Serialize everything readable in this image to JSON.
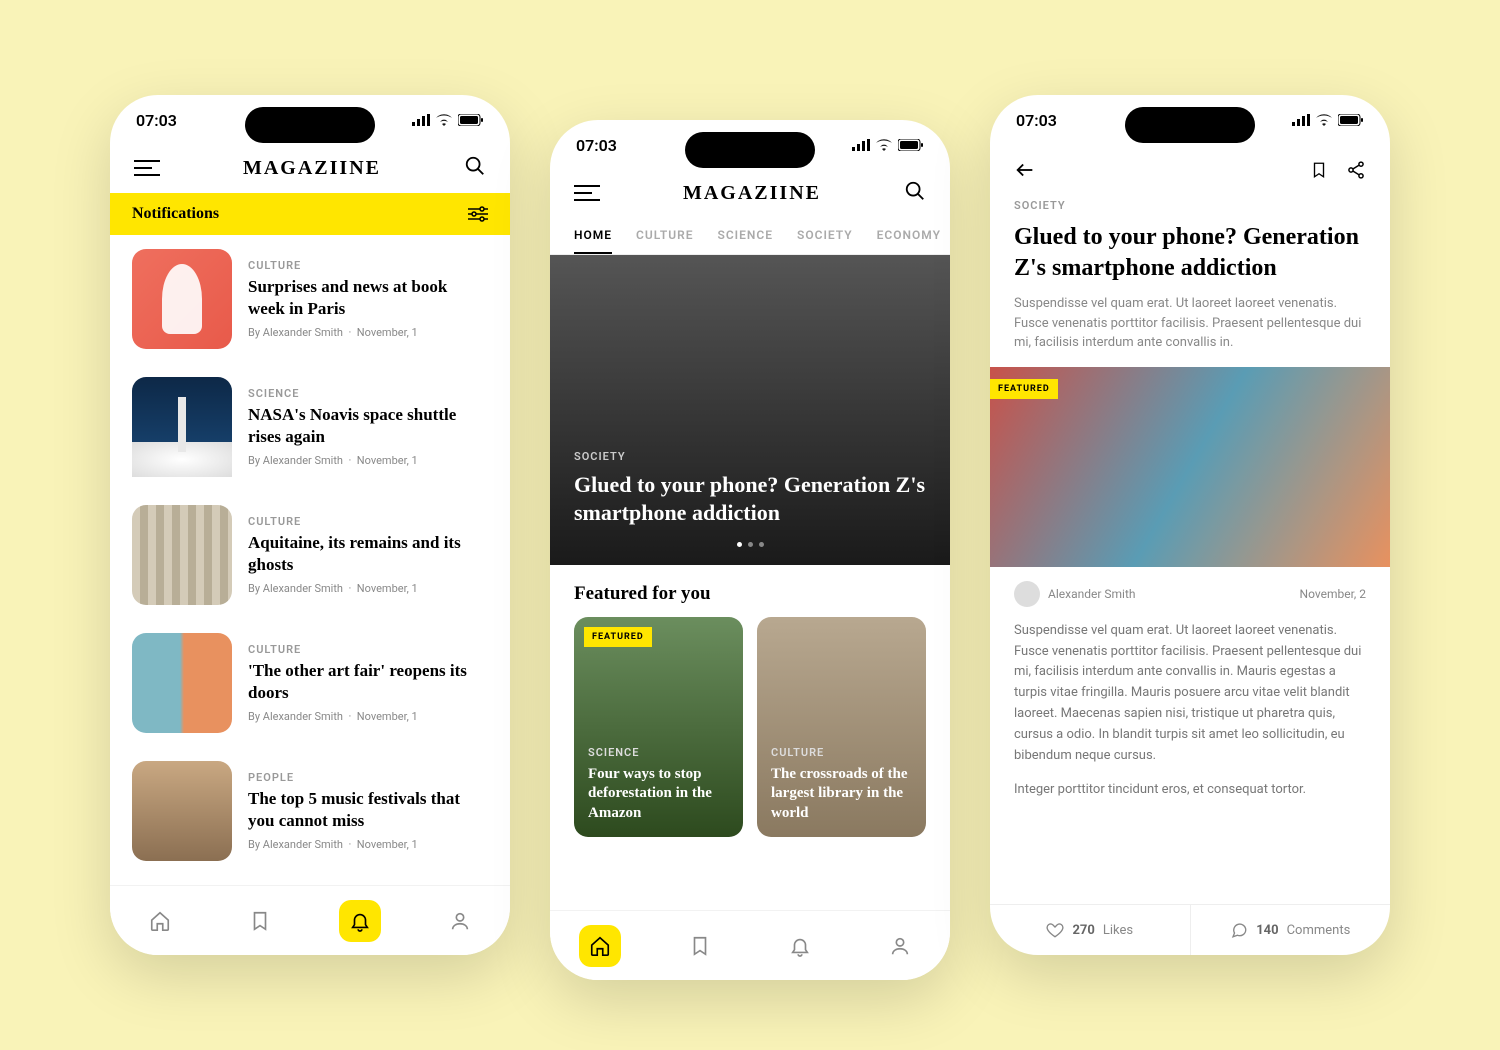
{
  "status": {
    "time": "07:03"
  },
  "brand": "MAGAZIINE",
  "screen1": {
    "header": "Notifications",
    "items": [
      {
        "category": "CULTURE",
        "title": "Surprises and news at book week in Paris",
        "author": "By Alexander Smith",
        "date": "November, 1"
      },
      {
        "category": "SCIENCE",
        "title": "NASA's Noavis space shuttle rises again",
        "author": "By Alexander Smith",
        "date": "November, 1"
      },
      {
        "category": "CULTURE",
        "title": "Aquitaine, its remains and its ghosts",
        "author": "By Alexander Smith",
        "date": "November, 1"
      },
      {
        "category": "CULTURE",
        "title": "'The other art fair' reopens its doors",
        "author": "By Alexander Smith",
        "date": "November, 1"
      },
      {
        "category": "PEOPLE",
        "title": "The top 5 music festivals that you cannot miss",
        "author": "By Alexander Smith",
        "date": "November, 1"
      }
    ]
  },
  "screen2": {
    "tabs": [
      "HOME",
      "CULTURE",
      "SCIENCE",
      "SOCIETY",
      "ECONOMY"
    ],
    "hero": {
      "category": "SOCIETY",
      "title": "Glued to your phone? Generation Z's smartphone addiction"
    },
    "section": "Featured for you",
    "featured_badge": "FEATURED",
    "cards": [
      {
        "category": "SCIENCE",
        "title": "Four ways to stop deforestation in the Amazon"
      },
      {
        "category": "CULTURE",
        "title": "The crossroads of the largest library in the world"
      }
    ]
  },
  "screen3": {
    "category": "SOCIETY",
    "title": "Glued to your phone? Generation Z's smartphone addiction",
    "lead": "Suspendisse vel quam erat. Ut laoreet laoreet venenatis. Fusce venenatis porttitor facilisis. Praesent pellentesque dui mi, facilisis interdum ante convallis in.",
    "featured_badge": "FEATURED",
    "author": "Alexander Smith",
    "date": "November, 2",
    "body1": "Suspendisse vel quam erat. Ut laoreet laoreet venenatis. Fusce venenatis porttitor facilisis. Praesent pellentesque dui mi, facilisis interdum ante convallis in. Mauris egestas a turpis vitae fringilla. Mauris posuere arcu vitae velit blandit laoreet. Maecenas sapien nisi, tristique ut pharetra quis, cursus a odio. In blandit turpis sit amet leo sollicitudin, eu bibendum neque cursus.",
    "body2": "Integer porttitor tincidunt eros, et consequat tortor.",
    "likes_count": "270",
    "likes_label": "Likes",
    "comments_count": "140",
    "comments_label": "Comments"
  }
}
